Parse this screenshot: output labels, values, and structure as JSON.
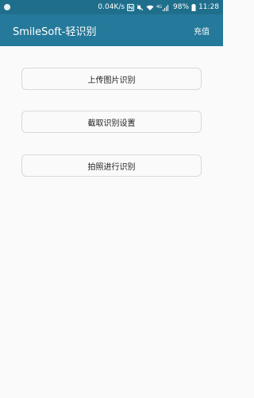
{
  "status_bar": {
    "network_speed": "0.04K/s",
    "battery": "98%",
    "time": "11:28",
    "signal_label": "4G",
    "colors": {
      "background": "#1f6f8c",
      "text": "#ffffff"
    }
  },
  "app_bar": {
    "title": "SmileSoft-轻识别",
    "recharge_label": "充值",
    "colors": {
      "background": "#25799a",
      "text": "#ffffff"
    }
  },
  "actions": [
    {
      "label": "上传图片识别"
    },
    {
      "label": "截取识别设置"
    },
    {
      "label": "拍照进行识别"
    }
  ]
}
